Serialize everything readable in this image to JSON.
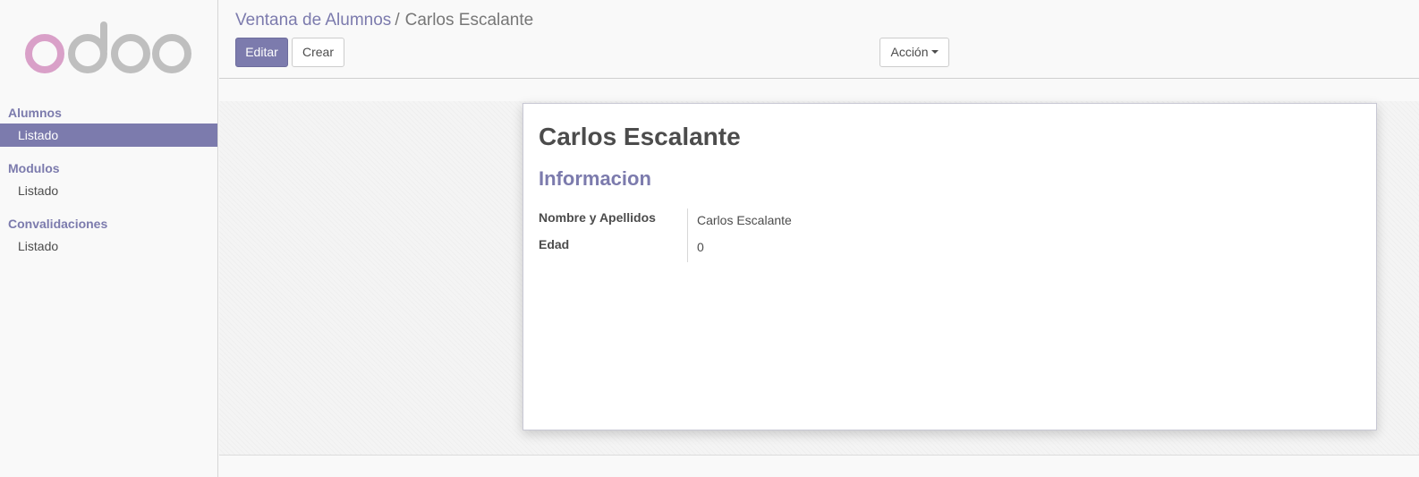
{
  "sidebar": {
    "logo_text": "odoo",
    "sections": [
      {
        "title": "Alumnos",
        "items": [
          {
            "label": "Listado",
            "active": true
          }
        ]
      },
      {
        "title": "Modulos",
        "items": [
          {
            "label": "Listado",
            "active": false
          }
        ]
      },
      {
        "title": "Convalidaciones",
        "items": [
          {
            "label": "Listado",
            "active": false
          }
        ]
      }
    ]
  },
  "breadcrumb": {
    "parent": "Ventana de Alumnos",
    "separator": "/",
    "current": "Carlos Escalante"
  },
  "toolbar": {
    "edit_label": "Editar",
    "create_label": "Crear",
    "action_label": "Acción"
  },
  "form": {
    "title": "Carlos Escalante",
    "group_title": "Informacion",
    "fields": [
      {
        "label": "Nombre y Apellidos",
        "value": "Carlos Escalante"
      },
      {
        "label": "Edad",
        "value": "0"
      }
    ]
  },
  "colors": {
    "brand": "#7c7bad",
    "logo_o_first": "#d9a0c8",
    "logo_rest": "#bfbfbf"
  },
  "icons": {
    "action_caret": "caret-down-icon"
  }
}
